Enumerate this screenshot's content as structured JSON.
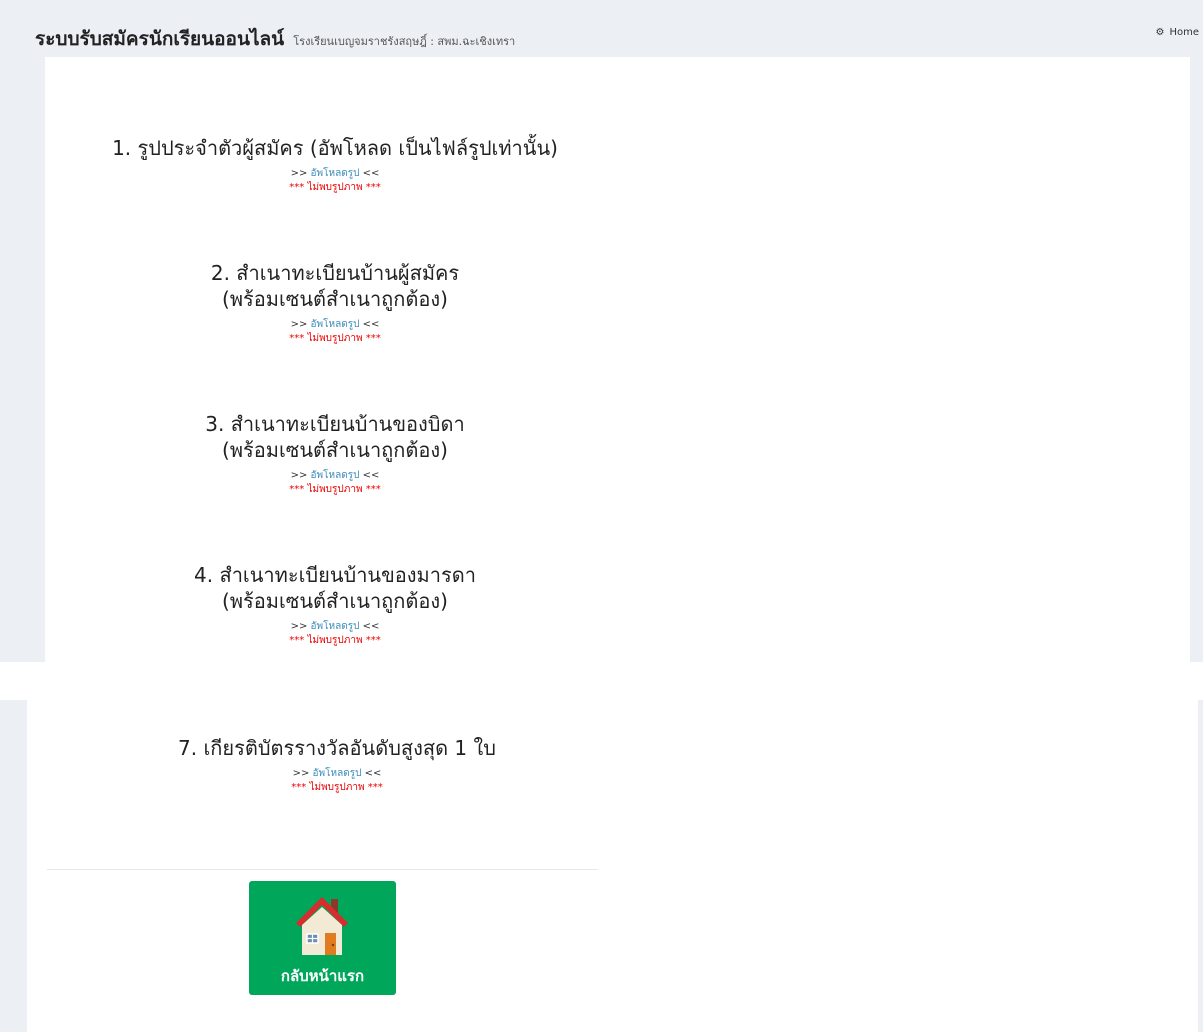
{
  "header": {
    "title": "ระบบรับสมัครนักเรียนออนไลน์",
    "subtitle": "โรงเรียนเบญจมราชรังสฤษฎิ์ : สพม.ฉะเชิงเทรา",
    "home_label": "Home",
    "home_icon": "dashboard-icon"
  },
  "documents": [
    {
      "title": "1. รูปประจำตัวผู้สมัคร (อัพโหลด เป็นไฟล์รูปเท่านั้น)",
      "upload_prefix": ">>",
      "upload_link": "อัพโหลดรูป",
      "upload_suffix": "<<",
      "status": "*** ไม่พบรูปภาพ ***"
    },
    {
      "title_line1": "2. สำเนาทะเบียนบ้านผู้สมัคร",
      "title_line2": "(พร้อมเซนต์สำเนาถูกต้อง)",
      "upload_prefix": ">>",
      "upload_link": "อัพโหลดรูป",
      "upload_suffix": "<<",
      "status": "*** ไม่พบรูปภาพ ***"
    },
    {
      "title_line1": "3. สำเนาทะเบียนบ้านของบิดา",
      "title_line2": "(พร้อมเซนต์สำเนาถูกต้อง)",
      "upload_prefix": ">>",
      "upload_link": "อัพโหลดรูป",
      "upload_suffix": "<<",
      "status": "*** ไม่พบรูปภาพ ***"
    },
    {
      "title_line1": "4. สำเนาทะเบียนบ้านของมารดา",
      "title_line2": "(พร้อมเซนต์สำเนาถูกต้อง)",
      "upload_prefix": ">>",
      "upload_link": "อัพโหลดรูป",
      "upload_suffix": "<<",
      "status": "*** ไม่พบรูปภาพ ***"
    },
    {
      "title": "7. เกียรติบัตรรางวัลอันดับสูงสุด 1 ใบ",
      "upload_prefix": ">>",
      "upload_link": "อัพโหลดรูป",
      "upload_suffix": "<<",
      "status": "*** ไม่พบรูปภาพ ***"
    }
  ],
  "back_button": {
    "label": "กลับหน้าแรก",
    "icon": "house-icon",
    "color": "#00a65a"
  },
  "colors": {
    "background": "#ecf0f5",
    "link": "#3c8dbc",
    "error": "#e00000"
  }
}
